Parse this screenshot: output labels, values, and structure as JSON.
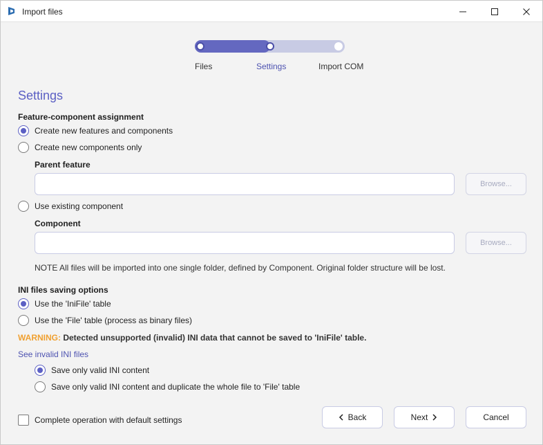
{
  "window": {
    "title": "Import files"
  },
  "stepper": {
    "steps": [
      {
        "label": "Files",
        "state": "done"
      },
      {
        "label": "Settings",
        "state": "current"
      },
      {
        "label": "Import COM",
        "state": "todo"
      }
    ],
    "progress_fraction": 0.5
  },
  "section_title": "Settings",
  "feature_assignment": {
    "label": "Feature-component assignment",
    "options": [
      {
        "label": "Create new features and components",
        "checked": true
      },
      {
        "label": "Create new components only",
        "checked": false
      },
      {
        "label": "Use existing component",
        "checked": false
      }
    ],
    "parent_feature": {
      "label": "Parent feature",
      "value": "",
      "browse_label": "Browse..."
    },
    "component": {
      "label": "Component",
      "value": "",
      "browse_label": "Browse..."
    },
    "note": "NOTE All files will be imported into one single folder, defined by Component. Original folder structure will be lost."
  },
  "ini_options": {
    "label": "INI files saving options",
    "options": [
      {
        "label": "Use the 'IniFile' table",
        "checked": true
      },
      {
        "label": "Use the 'File' table (process as binary files)",
        "checked": false
      }
    ],
    "warning_label": "WARNING:",
    "warning_text": "Detected unsupported (invalid) INI data that cannot be saved to 'IniFile' table.",
    "link_text": "See invalid INI files",
    "sub_options": [
      {
        "label": "Save only valid INI content",
        "checked": true
      },
      {
        "label": "Save only valid INI content and duplicate the whole file to 'File' table",
        "checked": false
      }
    ]
  },
  "footer": {
    "checkbox_label": "Complete operation with default settings",
    "checkbox_checked": false,
    "back_label": "Back",
    "next_label": "Next",
    "cancel_label": "Cancel"
  },
  "colors": {
    "accent": "#5c60c4",
    "warning": "#f0a030"
  },
  "icons": {
    "app": "app-icon",
    "minimize": "minimize-icon",
    "maximize": "maximize-icon",
    "close": "close-icon",
    "back": "chevron-left-icon",
    "next": "chevron-right-icon"
  }
}
